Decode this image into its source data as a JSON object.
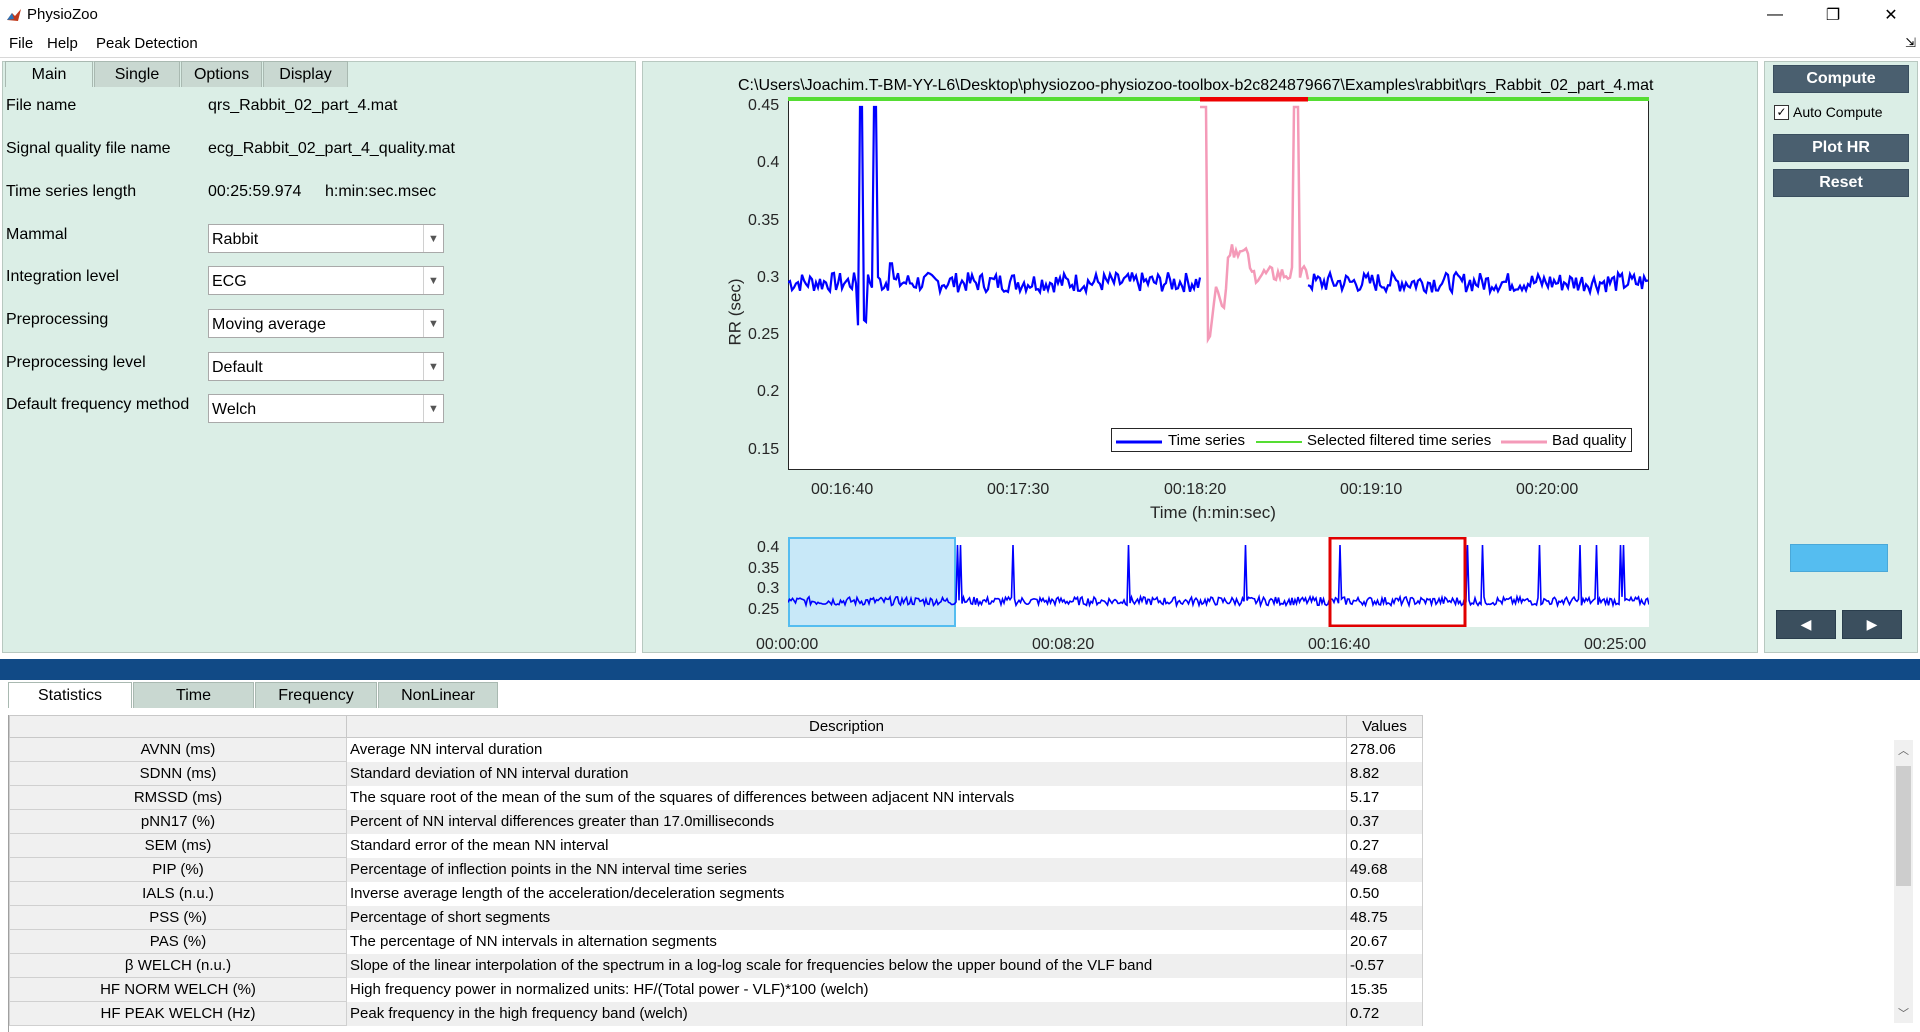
{
  "window": {
    "title": "PhysioZoo",
    "minimize": "—",
    "restore": "❐",
    "close": "✕"
  },
  "menu": {
    "items": [
      "File",
      "Help",
      "Peak Detection"
    ],
    "overflow": "⇲"
  },
  "left_panel": {
    "tabs": [
      "Main",
      "Single",
      "Options",
      "Display"
    ],
    "file_name_label": "File name",
    "file_name_value": "qrs_Rabbit_02_part_4.mat",
    "sq_label": "Signal quality file name",
    "sq_value": "ecg_Rabbit_02_part_4_quality.mat",
    "tsl_label": "Time series length",
    "tsl_value": "00:25:59.974",
    "tsl_unit": "h:min:sec.msec",
    "mammal_label": "Mammal",
    "mammal_value": "Rabbit",
    "integration_label": "Integration level",
    "integration_value": "ECG",
    "preprocessing_label": "Preprocessing",
    "preprocessing_value": "Moving average",
    "preprocessing_level_label": "Preprocessing level",
    "preprocessing_level_value": "Default",
    "freq_method_label": "Default frequency method",
    "freq_method_value": "Welch"
  },
  "plot": {
    "title": "C:\\Users\\Joachim.T-BM-YY-L6\\Desktop\\physiozoo-physiozoo-toolbox-b2c824879667\\Examples\\rabbit\\qrs_Rabbit_02_part_4.mat",
    "ylabel": "RR (sec)",
    "xlabel": "Time (h:min:sec)",
    "yticks": [
      "0.45",
      "0.4",
      "0.35",
      "0.3",
      "0.25",
      "0.2",
      "0.15"
    ],
    "xticks": [
      "00:16:40",
      "00:17:30",
      "00:18:20",
      "00:19:10",
      "00:20:00"
    ],
    "legend": [
      "Time series",
      "Selected filtered time series",
      "Bad quality"
    ],
    "colors": {
      "series": "#0000ff",
      "selected": "#55dd33",
      "bad": "#f49ab8",
      "bad_bar": "#ee0000"
    }
  },
  "overview": {
    "yticks": [
      "0.4",
      "0.35",
      "0.3",
      "0.25"
    ],
    "xticks": [
      "00:00:00",
      "00:08:20",
      "00:16:40",
      "00:25:00"
    ],
    "colors": {
      "window": "#c8e8f8",
      "window_border": "#55bdf0",
      "zoom_box": "#e00000"
    }
  },
  "right_panel": {
    "compute": "Compute",
    "auto_compute": "Auto Compute",
    "auto_checked": "✓",
    "plot_hr": "Plot HR",
    "reset": "Reset",
    "prev": "◀",
    "next": "▶"
  },
  "bottom": {
    "tabs": [
      "Statistics",
      "Time",
      "Frequency",
      "NonLinear"
    ],
    "table": {
      "headers": [
        "Description",
        "Values"
      ],
      "rows": [
        {
          "name": "AVNN (ms)",
          "desc": "Average NN interval duration",
          "value": "278.06"
        },
        {
          "name": "SDNN (ms)",
          "desc": "Standard deviation of NN interval duration",
          "value": "8.82"
        },
        {
          "name": "RMSSD (ms)",
          "desc": "The square root of the mean of the sum of the squares of differences between adjacent NN intervals",
          "value": "5.17"
        },
        {
          "name": "pNN17 (%)",
          "desc": "Percent of NN interval differences greater than 17.0milliseconds",
          "value": "0.37"
        },
        {
          "name": "SEM (ms)",
          "desc": "Standard error of the mean NN interval",
          "value": "0.27"
        },
        {
          "name": "PIP (%)",
          "desc": "Percentage of inflection points in the NN interval time series",
          "value": "49.68"
        },
        {
          "name": "IALS (n.u.)",
          "desc": "Inverse average length of the acceleration/deceleration segments",
          "value": "0.50"
        },
        {
          "name": "PSS (%)",
          "desc": "Percentage of short segments",
          "value": "48.75"
        },
        {
          "name": "PAS (%)",
          "desc": "The percentage of NN intervals in alternation segments",
          "value": "20.67"
        },
        {
          "name": "β WELCH (n.u.)",
          "desc": "Slope of the linear interpolation of the spectrum in a log-log scale for frequencies below the upper bound of the VLF band",
          "value": "-0.57"
        },
        {
          "name": "HF NORM WELCH (%)",
          "desc": "High frequency power in normalized units: HF/(Total power - VLF)*100 (welch)",
          "value": "15.35"
        },
        {
          "name": "HF PEAK WELCH (Hz)",
          "desc": "Peak frequency in the high frequency band (welch)",
          "value": "0.72"
        }
      ]
    },
    "scroll_up": "︿",
    "scroll_down": "﹀"
  }
}
